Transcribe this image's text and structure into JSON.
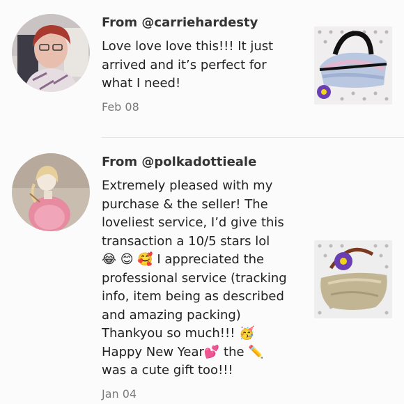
{
  "reviews": [
    {
      "from": "From @carriehardesty",
      "text": "Love love love this!!! It just\narrived and it’s perfect for\nwhat I need!",
      "date": "Feb 08"
    },
    {
      "from": "From @polkadottieale",
      "text": "Extremely pleased with my\npurchase & the seller! The\nloveliest service, I’d give this\ntransaction a 10/5 stars lol\n😂 😊 🥰 I appreciated the\nprofessional service (tracking\ninfo, item being as described\nand amazing packing)\nThankyou so much!!! 🥳\nHappy New Year💕 the ✏️\nwas a cute gift too!!!",
      "date": "Jan 04"
    }
  ]
}
